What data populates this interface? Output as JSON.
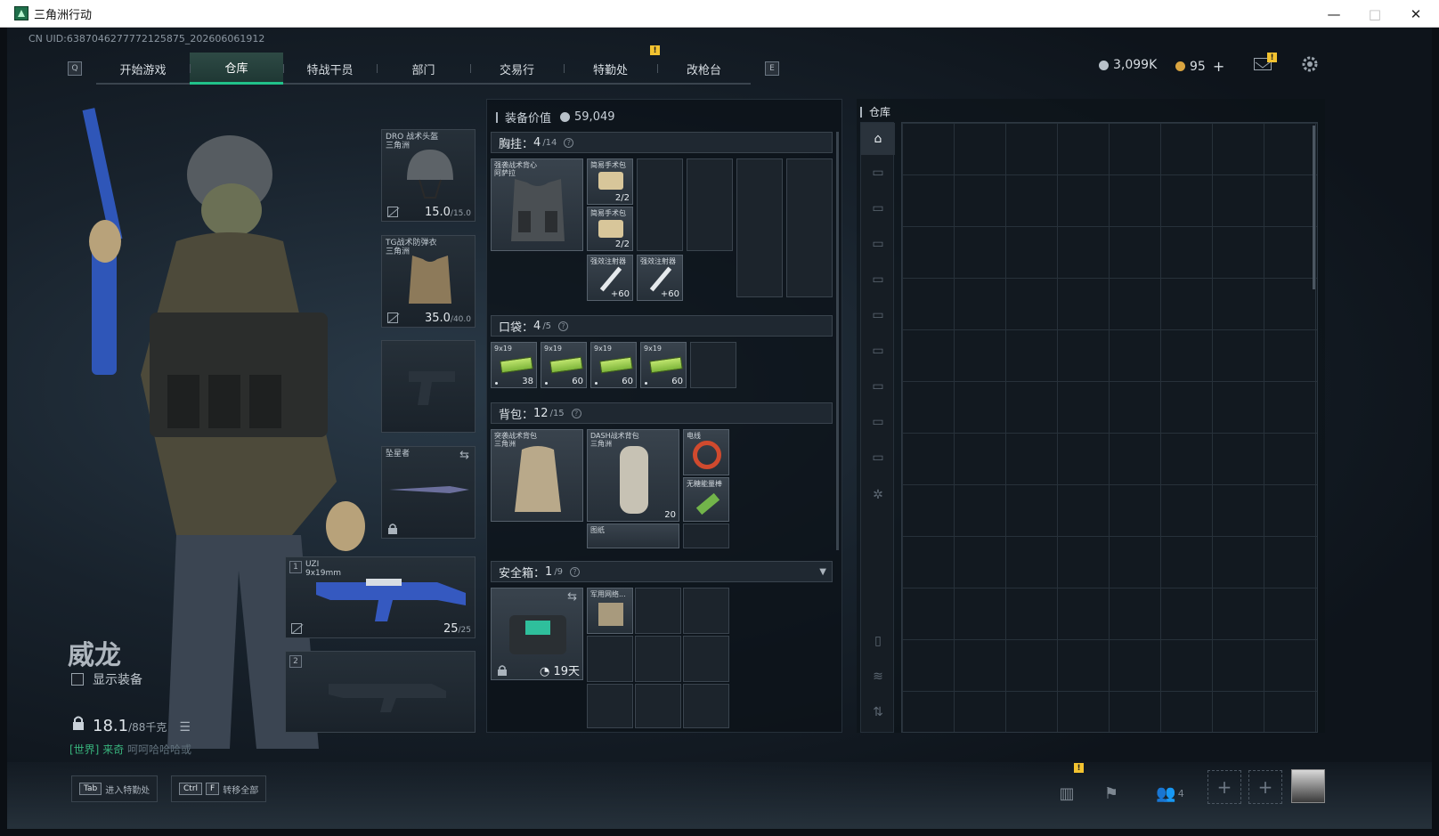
{
  "window": {
    "title": "三角洲行动",
    "minimize": "—",
    "maximize": "□",
    "close": "✕"
  },
  "uid": "CN UID:6387046277772125875_202606061912",
  "nav": {
    "left_key": "Q",
    "right_key": "E",
    "tabs": [
      "开始游戏",
      "仓库",
      "特战干员",
      "部门",
      "交易行",
      "特勤处",
      "改枪台"
    ],
    "active_tab": "仓库",
    "alert": "!"
  },
  "currency": {
    "coins": "3,099K",
    "tickets": "95",
    "add": "+"
  },
  "top_icons": {
    "mail_alert": "!"
  },
  "character": {
    "name": "威龙",
    "show_equipment_label": "显示装备",
    "weight": "18.1",
    "weight_max": "/88千克",
    "chat_channel": "[世界]",
    "chat_user": "来奇",
    "chat_text": "呵呵哈哈哈或"
  },
  "equipment": {
    "helmet": {
      "name": "DRO 战术头盔",
      "sub": "三角洲",
      "dur": "15.0",
      "max": "/15.0"
    },
    "armor": {
      "name": "TG战术防弹衣",
      "sub": "三角洲",
      "dur": "35.0",
      "max": "/40.0"
    },
    "melee": {
      "name": "坠星者"
    },
    "primary": {
      "slot": "1",
      "name": "UZI",
      "sub": "9x19mm",
      "ammo": "25",
      "ammo_max": "/25"
    },
    "secondary": {
      "slot": "2"
    }
  },
  "stash_value": {
    "label": "装备价值",
    "value": "59,049"
  },
  "chest": {
    "label": "胸挂",
    "count": "4",
    "cap": "/14",
    "q": "?",
    "items": [
      {
        "name": "强袭战术背心",
        "sub": "阿萨拉"
      },
      {
        "name": "简易手术包",
        "cnt": "2/2"
      },
      {
        "name": "简易手术包",
        "cnt": "2/2"
      },
      {
        "name": "强效注射器",
        "cnt": "+60"
      },
      {
        "name": "强效注射器",
        "cnt": "+60"
      }
    ]
  },
  "pocket": {
    "label": "口袋",
    "count": "4",
    "cap": "/5",
    "q": "?",
    "items": [
      {
        "name": "9x19",
        "cnt": "38"
      },
      {
        "name": "9x19",
        "cnt": "60"
      },
      {
        "name": "9x19",
        "cnt": "60"
      },
      {
        "name": "9x19",
        "cnt": "60"
      }
    ]
  },
  "backpack": {
    "label": "背包",
    "count": "12",
    "cap": "/15",
    "q": "?",
    "items": [
      {
        "name": "突袭战术背包",
        "sub": "三角洲"
      },
      {
        "name": "DASH战术背包",
        "sub": "三角洲",
        "cnt": "20"
      },
      {
        "name": "电线"
      },
      {
        "name": "无糖能量棒"
      },
      {
        "name": "图纸"
      }
    ]
  },
  "safebox": {
    "label": "安全箱",
    "count": "1",
    "cap": "/9",
    "q": "?",
    "time": "19天",
    "items": [
      {
        "name": "军用网络..."
      }
    ]
  },
  "warehouse": {
    "title": "仓库"
  },
  "hints": [
    {
      "keys": [
        "Tab"
      ],
      "label": "进入特勤处"
    },
    {
      "keys": [
        "Ctrl",
        "F"
      ],
      "label": "转移全部"
    }
  ],
  "bottom": {
    "squad_count": "4",
    "stats_alert": "!"
  },
  "colors": {
    "accent": "#21c28a",
    "warning": "#f2c230",
    "panel": "#1f2831"
  }
}
